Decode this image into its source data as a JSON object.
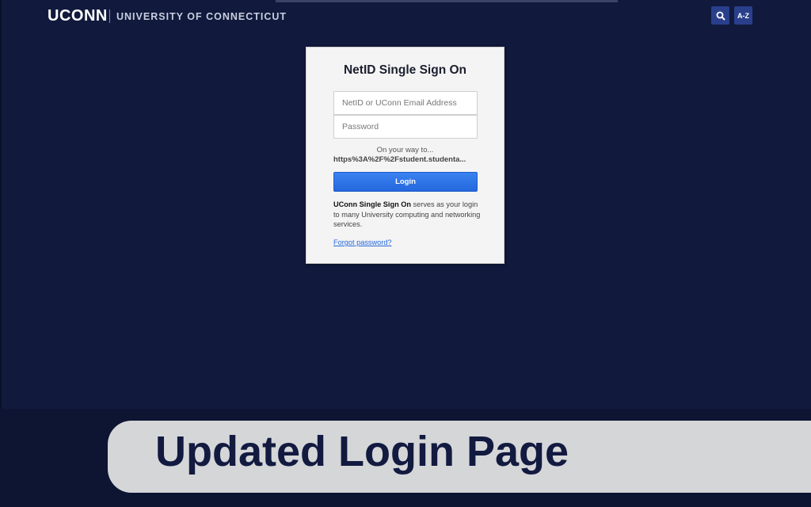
{
  "header": {
    "logo_wordmark": "UCONN",
    "logo_university": "UNIVERSITY OF CONNECTICUT",
    "search_icon": "search-icon",
    "az_label": "A-Z"
  },
  "login": {
    "title": "NetID Single Sign On",
    "username_placeholder": "NetID or UConn Email Address",
    "password_placeholder": "Password",
    "on_your_way": "On your way to...",
    "destination": "https%3A%2F%2Fstudent.studenta...",
    "login_button": "Login",
    "description_bold": "UConn Single Sign On",
    "description_rest": " serves as your login to many University computing and networking services.",
    "forgot_link": "Forgot password?"
  },
  "banner": {
    "text": "Updated Login Page"
  },
  "colors": {
    "background": "#111a3d",
    "accent": "#2468dd",
    "header_button": "#2a3f8c",
    "banner": "#d5d6d8"
  }
}
